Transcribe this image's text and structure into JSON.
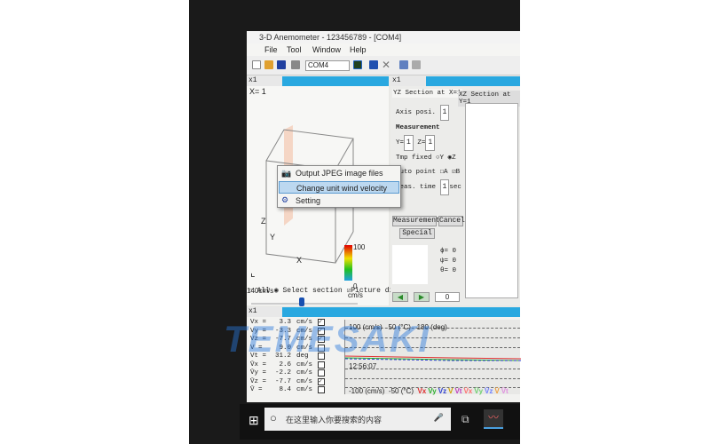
{
  "window": {
    "title": "3-D Anemometer - 123456789 - [COM4]"
  },
  "menu": [
    "File",
    "Tool",
    "Window",
    "Help"
  ],
  "toolbar": {
    "port": "COM4"
  },
  "left_panel": {
    "selector": "x1",
    "x_label": "X= 1",
    "axis_z": "Z",
    "axis_y": "Y",
    "axis_x": "X",
    "scale_top": "40",
    "legend_max": "100",
    "legend_min": "0",
    "legend_unit": "cm/s",
    "scale_label": "140cm/s",
    "radio_all": "All",
    "radio_select": "Select section",
    "picture_label": "Picture di"
  },
  "context_menu": {
    "items": [
      {
        "label": "Output JPEG image files",
        "icon": "camera-icon"
      },
      {
        "label": "Change unit wind velocity",
        "highlighted": true
      },
      {
        "label": "Setting",
        "icon": "gear-icon"
      }
    ]
  },
  "right_panel": {
    "selector": "x1",
    "tabs": [
      "YZ Section at X=1",
      "XZ Section at Y=1"
    ],
    "axis_posi_label": "Axis posi.",
    "axis_posi": "1",
    "measurement_label": "Measurement",
    "y_label": "Y=",
    "y_value": "1",
    "z_label": "Z=",
    "z_value": "1",
    "tmp_fixed_label": "Tmp fixed",
    "radio_y": "Y",
    "radio_z": "Z",
    "auto_point_label": "Auto point",
    "check_a": "A",
    "check_b": "B",
    "meas_time_label": "Meas. time",
    "meas_time": "1",
    "meas_time_unit": "sec",
    "measurement_button": "Measurement",
    "cancel_button": "Cancel",
    "special_button": "Special",
    "phi": "ϕ=  0",
    "psi": "ψ=  0",
    "theta": "θ=  0",
    "counter": "0"
  },
  "bottom_panel": {
    "selector": "x1",
    "readings": [
      {
        "name": "Vx =",
        "value": "3.3",
        "unit": "cm/s",
        "checked": true
      },
      {
        "name": "Vy =",
        "value": "-3.3",
        "unit": "cm/s",
        "checked": true
      },
      {
        "name": "Vz =",
        "value": "-7.7",
        "unit": "cm/s",
        "checked": true
      },
      {
        "name": "V  =",
        "value": "9.0",
        "unit": "cm/s",
        "checked": false
      },
      {
        "name": "Vt =",
        "value": "31.2",
        "unit": "deg",
        "checked": false
      },
      {
        "name": "V̄x =",
        "value": "2.6",
        "unit": "cm/s",
        "checked": false
      },
      {
        "name": "V̄y =",
        "value": "-2.2",
        "unit": "cm/s",
        "checked": false
      },
      {
        "name": "V̄z =",
        "value": "-7.7",
        "unit": "cm/s",
        "checked": true
      },
      {
        "name": "V̄  =",
        "value": "8.4",
        "unit": "cm/s",
        "checked": false
      }
    ],
    "chart_top": [
      "100 (cm/s)",
      "50 (°C)",
      "180 (deg)"
    ],
    "chart_bottom": [
      "-100 (cm/s)",
      "-50 (°C)"
    ],
    "time": "12:56:07",
    "legend": [
      {
        "label": "Vx",
        "color": "#e03030"
      },
      {
        "label": "Vy",
        "color": "#30b030"
      },
      {
        "label": "Vz",
        "color": "#3040d0"
      },
      {
        "label": "V",
        "color": "#d0a000"
      },
      {
        "label": "Vt",
        "color": "#c040c0"
      },
      {
        "label": "V̄x",
        "color": "#ff7070"
      },
      {
        "label": "V̄y",
        "color": "#70d070"
      },
      {
        "label": "V̄z",
        "color": "#7080ff"
      },
      {
        "label": "V̄",
        "color": "#f0a040"
      },
      {
        "label": "V̄t",
        "color": "#e090e0"
      }
    ]
  },
  "taskbar": {
    "search_placeholder": "在这里输入你要搜索的内容"
  },
  "watermark": "TEMESAKI"
}
